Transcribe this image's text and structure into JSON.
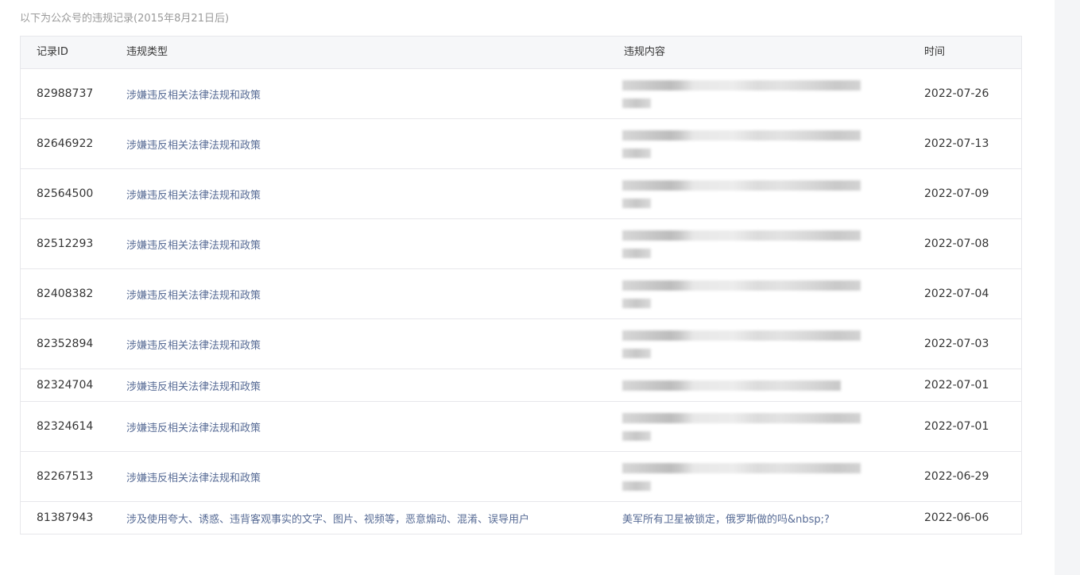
{
  "caption": "以下为公众号的违规记录(2015年8月21日后)",
  "columns": {
    "id": "记录ID",
    "type": "违规类型",
    "content": "违规内容",
    "time": "时间"
  },
  "rows": [
    {
      "id": "82988737",
      "type": "涉嫌违反相关法律法规和政策",
      "content": "",
      "time": "2022-07-26"
    },
    {
      "id": "82646922",
      "type": "涉嫌违反相关法律法规和政策",
      "content": "",
      "time": "2022-07-13"
    },
    {
      "id": "82564500",
      "type": "涉嫌违反相关法律法规和政策",
      "content": "",
      "time": "2022-07-09"
    },
    {
      "id": "82512293",
      "type": "涉嫌违反相关法律法规和政策",
      "content": "",
      "time": "2022-07-08"
    },
    {
      "id": "82408382",
      "type": "涉嫌违反相关法律法规和政策",
      "content": "",
      "time": "2022-07-04"
    },
    {
      "id": "82352894",
      "type": "涉嫌违反相关法律法规和政策",
      "content": "",
      "time": "2022-07-03"
    },
    {
      "id": "82324704",
      "type": "涉嫌违反相关法律法规和政策",
      "content": "",
      "time": "2022-07-01"
    },
    {
      "id": "82324614",
      "type": "涉嫌违反相关法律法规和政策",
      "content": "",
      "time": "2022-07-01"
    },
    {
      "id": "82267513",
      "type": "涉嫌违反相关法律法规和政策",
      "content": "",
      "time": "2022-06-29"
    },
    {
      "id": "81387943",
      "type": "涉及使用夸大、诱惑、违背客观事实的文字、图片、视频等，恶意煽动、混淆、误导用户",
      "content": "美军所有卫星被锁定，俄罗斯做的吗&nbsp;?",
      "time": "2022-06-06"
    }
  ]
}
